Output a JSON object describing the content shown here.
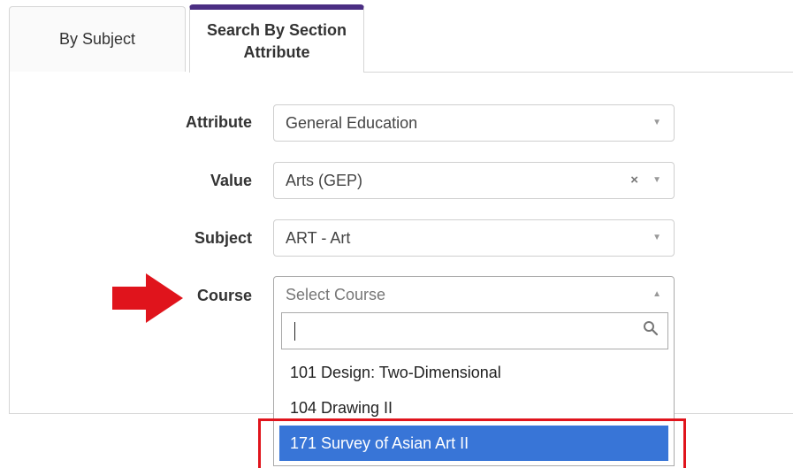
{
  "tabs": [
    {
      "label": "By Subject",
      "active": false
    },
    {
      "label": "Search By Section Attribute",
      "active": true
    }
  ],
  "form": {
    "attribute": {
      "label": "Attribute",
      "value": "General Education"
    },
    "value": {
      "label": "Value",
      "value": "Arts (GEP)",
      "clear_icon": "clear-x-icon"
    },
    "subject": {
      "label": "Subject",
      "value": "ART - Art"
    },
    "course": {
      "label": "Course",
      "placeholder": "Select Course",
      "state": "open"
    }
  },
  "dropdown": {
    "search_value": "",
    "search_icon": "search-icon",
    "options": [
      {
        "label": "101 Design: Two-Dimensional",
        "highlighted": false
      },
      {
        "label": "104 Drawing II",
        "highlighted": false
      },
      {
        "label": "171 Survey of Asian Art II",
        "highlighted": true
      }
    ]
  },
  "annotations": {
    "arrow_color": "#e0141c",
    "highlight_box_color": "#e0141c"
  },
  "colors": {
    "active_tab_accent": "#4b2e83",
    "option_highlight": "#3875d7"
  }
}
